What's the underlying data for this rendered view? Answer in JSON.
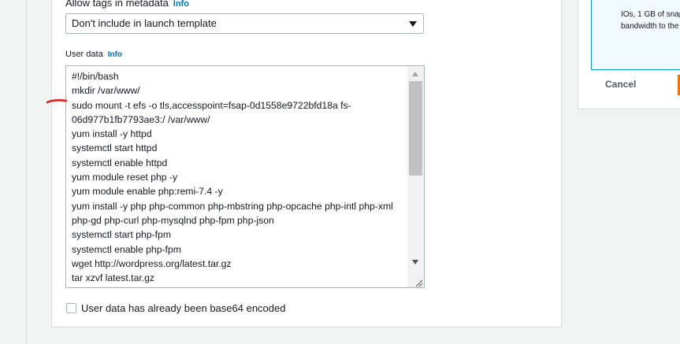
{
  "tags_metadata": {
    "label": "Allow tags in metadata",
    "info": "Info",
    "selected": "Don't include in launch template"
  },
  "user_data": {
    "label": "User data",
    "info": "Info",
    "lines": [
      "#!/bin/bash",
      "mkdir /var/www/",
      "sudo mount -t efs -o tls,accesspoint=fsap-0d1558e9722bfd18a fs-",
      "06d977b1fb7793ae3:/ /var/www/",
      "yum install -y httpd",
      "systemctl start httpd",
      "systemctl enable httpd",
      "yum module reset php -y",
      "yum module enable php:remi-7.4 -y",
      "yum install -y php php-common php-mbstring php-opcache php-intl php-xml",
      "php-gd php-curl php-mysqlnd php-fpm php-json",
      "systemctl start php-fpm",
      "systemctl enable php-fpm",
      "wget http://wordpress.org/latest.tar.gz",
      "tar xzvf latest.tar.gz"
    ]
  },
  "base64_checkbox": {
    "label": "User data has already been base64 encoded",
    "checked": false
  },
  "summary": {
    "info_lines": [
      "IOs, 1 GB of snap",
      "bandwidth to the"
    ],
    "cancel_label": "Cancel"
  },
  "colors": {
    "link": "#0073bb",
    "annotation": "#e02020",
    "primary": "#ec7211"
  }
}
